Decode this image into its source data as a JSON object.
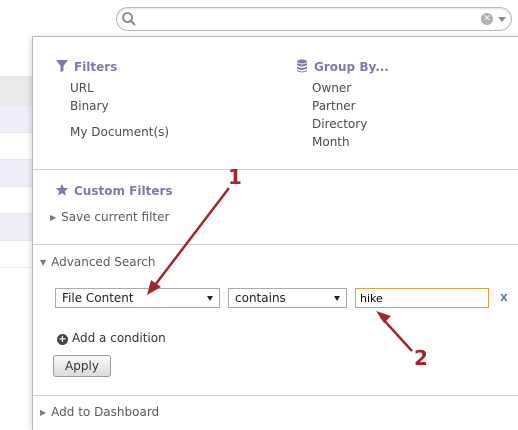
{
  "search": {
    "value": "",
    "placeholder": ""
  },
  "filters": {
    "heading": "Filters",
    "items": [
      "URL",
      "Binary",
      "My Document(s)"
    ]
  },
  "group_by": {
    "heading": "Group By...",
    "items": [
      "Owner",
      "Partner",
      "Directory",
      "Month"
    ]
  },
  "custom_filters": {
    "heading": "Custom Filters",
    "save_label": "Save current filter"
  },
  "advanced_search": {
    "label": "Advanced Search",
    "field_select": "File Content",
    "operator_select": "contains",
    "value": "hike",
    "remove_label": "x",
    "add_condition_label": "Add a condition",
    "apply_label": "Apply"
  },
  "dashboard": {
    "label": "Add to Dashboard"
  },
  "annotations": {
    "label_1": "1",
    "label_2": "2",
    "color": "#a3262a"
  },
  "colors": {
    "accent": "#7c7bad",
    "input_focus": "#e0a040"
  }
}
